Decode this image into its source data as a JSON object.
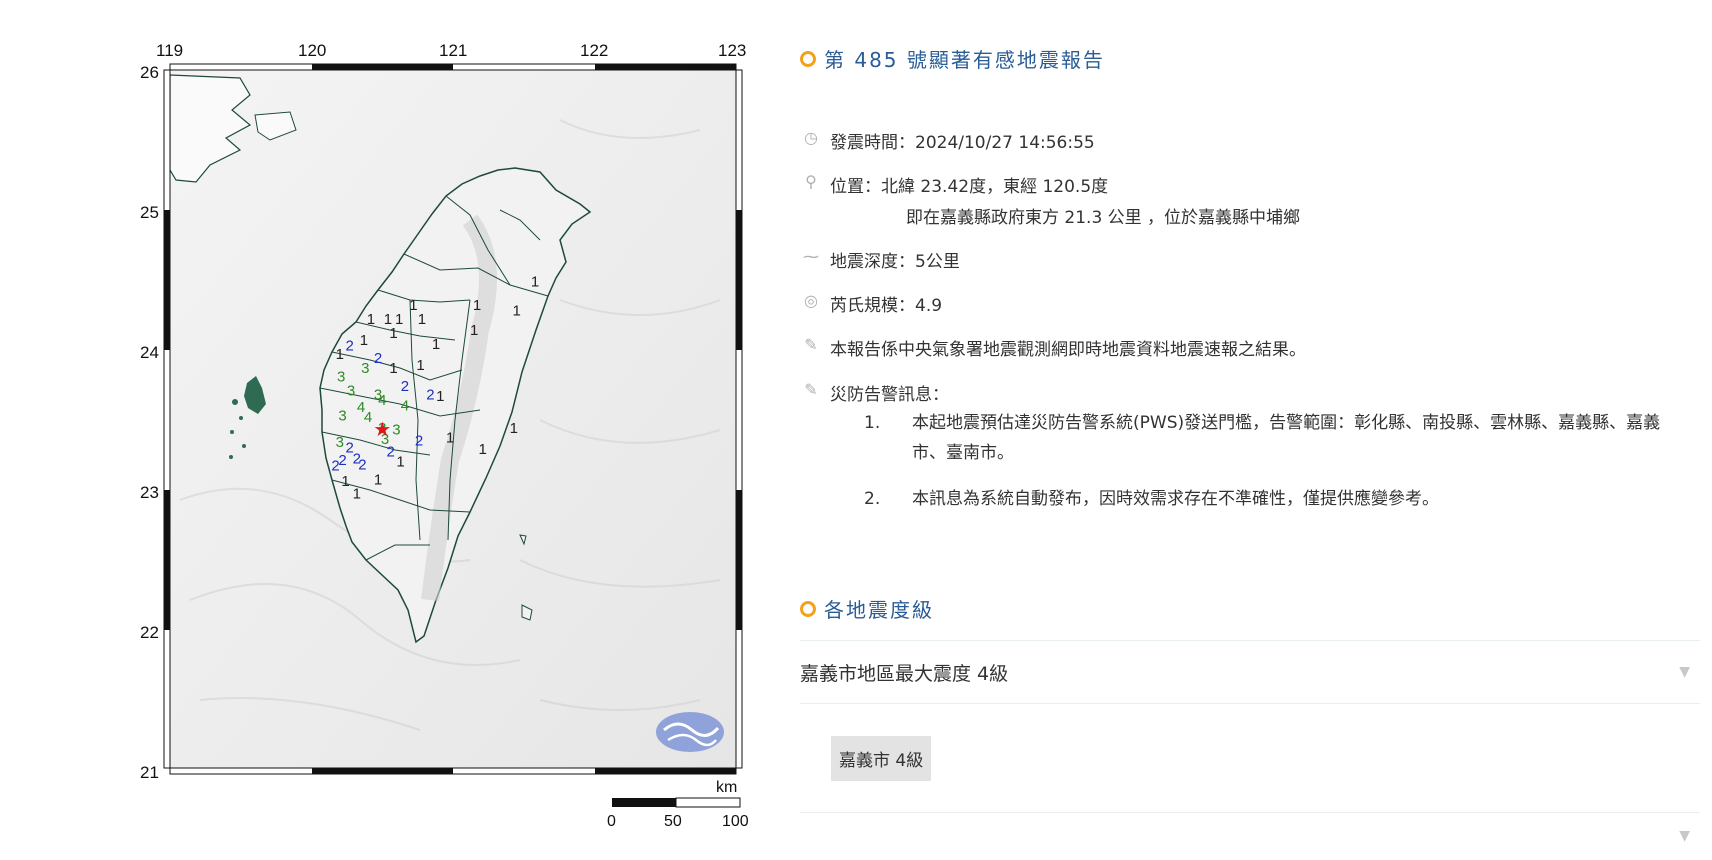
{
  "map": {
    "lon_ticks": [
      "119",
      "120",
      "121",
      "122",
      "123"
    ],
    "lat_ticks": [
      "26",
      "25",
      "24",
      "23",
      "22",
      "21"
    ],
    "scale": {
      "unit": "km",
      "labels": [
        "0",
        "50",
        "100"
      ]
    },
    "epicenter": {
      "lon": 120.5,
      "lat": 23.42
    },
    "intensity_colors": {
      "1": "#222222",
      "2": "#1d2fc4",
      "3": "#2e8b22",
      "4": "#2e8b22"
    },
    "stations": [
      {
        "v": "1",
        "lon": 120.72,
        "lat": 24.28
      },
      {
        "v": "1",
        "lon": 121.17,
        "lat": 24.28
      },
      {
        "v": "1",
        "lon": 120.54,
        "lat": 24.18
      },
      {
        "v": "1",
        "lon": 120.62,
        "lat": 24.18
      },
      {
        "v": "1",
        "lon": 120.78,
        "lat": 24.18
      },
      {
        "v": "1",
        "lon": 120.42,
        "lat": 24.18
      },
      {
        "v": "1",
        "lon": 120.58,
        "lat": 24.08
      },
      {
        "v": "1",
        "lon": 120.37,
        "lat": 24.03
      },
      {
        "v": "1",
        "lon": 120.88,
        "lat": 24.0
      },
      {
        "v": "2",
        "lon": 120.27,
        "lat": 23.99
      },
      {
        "v": "1",
        "lon": 120.2,
        "lat": 23.93
      },
      {
        "v": "2",
        "lon": 120.47,
        "lat": 23.9
      },
      {
        "v": "1",
        "lon": 120.58,
        "lat": 23.83
      },
      {
        "v": "3",
        "lon": 120.38,
        "lat": 23.83
      },
      {
        "v": "1",
        "lon": 120.77,
        "lat": 23.85
      },
      {
        "v": "3",
        "lon": 120.21,
        "lat": 23.77
      },
      {
        "v": "2",
        "lon": 120.66,
        "lat": 23.7
      },
      {
        "v": "3",
        "lon": 120.28,
        "lat": 23.67
      },
      {
        "v": "3",
        "lon": 120.47,
        "lat": 23.64
      },
      {
        "v": "4",
        "lon": 120.5,
        "lat": 23.6
      },
      {
        "v": "2",
        "lon": 120.84,
        "lat": 23.64
      },
      {
        "v": "1",
        "lon": 120.91,
        "lat": 23.63
      },
      {
        "v": "4",
        "lon": 120.35,
        "lat": 23.55
      },
      {
        "v": "4",
        "lon": 120.66,
        "lat": 23.56
      },
      {
        "v": "3",
        "lon": 120.22,
        "lat": 23.49
      },
      {
        "v": "4",
        "lon": 120.4,
        "lat": 23.48
      },
      {
        "v": "3",
        "lon": 120.5,
        "lat": 23.4
      },
      {
        "v": "3",
        "lon": 120.6,
        "lat": 23.39
      },
      {
        "v": "3",
        "lon": 120.52,
        "lat": 23.32
      },
      {
        "v": "2",
        "lon": 120.76,
        "lat": 23.31
      },
      {
        "v": "1",
        "lon": 120.98,
        "lat": 23.33
      },
      {
        "v": "1",
        "lon": 121.21,
        "lat": 23.25
      },
      {
        "v": "3",
        "lon": 120.2,
        "lat": 23.3
      },
      {
        "v": "2",
        "lon": 120.27,
        "lat": 23.26
      },
      {
        "v": "2",
        "lon": 120.56,
        "lat": 23.23
      },
      {
        "v": "2",
        "lon": 120.22,
        "lat": 23.17
      },
      {
        "v": "2",
        "lon": 120.32,
        "lat": 23.18
      },
      {
        "v": "2",
        "lon": 120.17,
        "lat": 23.13
      },
      {
        "v": "2",
        "lon": 120.36,
        "lat": 23.14
      },
      {
        "v": "1",
        "lon": 120.63,
        "lat": 23.16
      },
      {
        "v": "1",
        "lon": 120.47,
        "lat": 23.03
      },
      {
        "v": "1",
        "lon": 120.24,
        "lat": 23.02
      },
      {
        "v": "1",
        "lon": 120.32,
        "lat": 22.93
      },
      {
        "v": "1",
        "lon": 121.43,
        "lat": 23.4
      },
      {
        "v": "1",
        "lon": 121.58,
        "lat": 24.45
      },
      {
        "v": "1",
        "lon": 121.45,
        "lat": 24.24
      },
      {
        "v": "1",
        "lon": 121.15,
        "lat": 24.1
      }
    ]
  },
  "report": {
    "title": "第 485 號顯著有感地震報告",
    "time_label": "發震時間：2024/10/27 14:56:55",
    "location_label": "位置：北緯 23.42度，東經 120.5度",
    "location_sub": "即在嘉義縣政府東方 21.3 公里 ，位於嘉義縣中埔鄉",
    "depth_label": "地震深度：5公里",
    "magnitude_label": "芮氏規模：4.9",
    "source_note": "本報告係中央氣象署地震觀測網即時地震資料地震速報之結果。",
    "warning_label": "災防告警訊息：",
    "warnings": [
      {
        "num": "1.",
        "text": "本起地震預估達災防告警系統(PWS)發送門檻，告警範圍：彰化縣、南投縣、雲林縣、嘉義縣、嘉義市、臺南市。"
      },
      {
        "num": "2.",
        "text": "本訊息為系統自動發布，因時效需求存在不準確性，僅提供應變參考。"
      }
    ]
  },
  "intensity": {
    "title": "各地震度級",
    "region_header": "嘉義市地區最大震度 4級",
    "area_chip": "嘉義市 4級"
  },
  "icons": {
    "clock": "clock-icon",
    "pin": "location-pin-icon",
    "depth": "depth-wave-icon",
    "magnitude": "magnitude-icon",
    "megaphone": "megaphone-icon",
    "caret": "caret-down-icon"
  }
}
